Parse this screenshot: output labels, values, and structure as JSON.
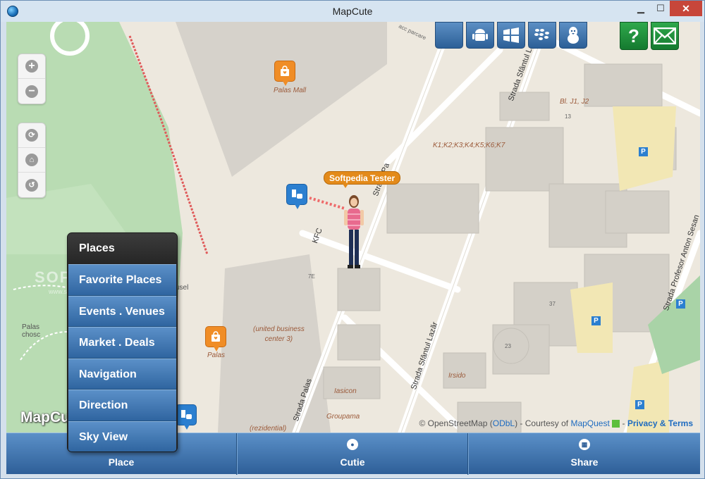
{
  "window": {
    "title": "MapCute"
  },
  "map": {
    "labels": {
      "acc_parcare": "acc parcare",
      "palas_mall": "Palas Mall",
      "bl_j1j2": "Bl. J1, J2",
      "num13": "13",
      "k_blocks": "K1;K2;K3;K4;K5;K6;K7",
      "strada_stantul_lazar_top": "Strada Sfântul Lazăr",
      "strada_palas_top": "Strada Pa",
      "kfc": "KFC",
      "num7e": "7E",
      "usel": "usel",
      "palas_chosc": "Palas\nchosc",
      "palas": "Palas",
      "united_business": "(united business\ncenter 3)",
      "num37": "37",
      "num23": "23",
      "irsido": "Irsido",
      "iasicon": "Iasicon",
      "groupama": "Groupama",
      "rezidential": "(rezidential)",
      "strada_palas_bottom": "Strada Palas",
      "strada_stantul_lazar_bottom": "Strada Sfântul Lazăr",
      "strada_profesor": "Strada Profesor Anton Sesan",
      "parking": "P"
    },
    "user_bubble": "Softpedia Tester",
    "brand": "MapCu",
    "watermark": "SOFTPEDIA",
    "watermark_url": "www.softpedia.com",
    "attribution": {
      "prefix": "© OpenStreetMap (",
      "odbl": "ODbL",
      "mid": ") - Courtesy of ",
      "mapquest": "MapQuest",
      "sep": " - ",
      "privacy": "Privacy & Terms"
    }
  },
  "controls": {
    "zoom_in": "+",
    "zoom_out": "−"
  },
  "icons": {
    "zoom_in": "plus-icon",
    "zoom_out": "minus-icon",
    "locate": "locate-icon",
    "home": "home-icon",
    "reset": "reset-icon",
    "apple": "apple-icon",
    "android": "android-icon",
    "windows": "windows-icon",
    "blackberry": "blackberry-icon",
    "linux": "linux-icon",
    "help": "help-icon",
    "mail": "mail-icon"
  },
  "help_label": "?",
  "menu": {
    "header": "Places",
    "items": [
      "Favorite Places",
      "Events . Venues",
      "Market . Deals",
      "Navigation",
      "Direction",
      "Sky View"
    ]
  },
  "bottom_tabs": [
    {
      "label": "Place"
    },
    {
      "label": "Cutie"
    },
    {
      "label": "Share"
    }
  ],
  "colors": {
    "accent_blue": "#2e5f98",
    "poi_orange": "#f08d26",
    "help_green": "#157a2f",
    "park_green": "#a9d3a7"
  }
}
